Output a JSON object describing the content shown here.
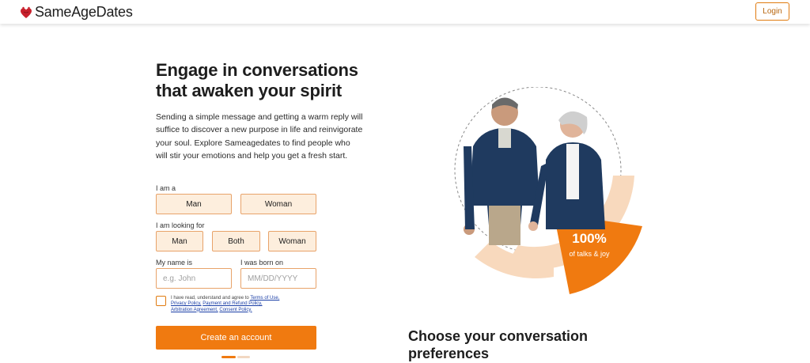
{
  "header": {
    "logo_text": "SameAgeDates",
    "login_label": "Login"
  },
  "hero": {
    "title_line1": "Engage in conversations",
    "title_line2": "that awaken your spirit",
    "description": "Sending a simple message and getting a warm reply will suffice to discover a new purpose in life and reinvigorate your soul. Explore Sameagedates to find people who will stir your emotions and help you get a fresh start."
  },
  "form": {
    "i_am_label": "I am a",
    "i_am_options": [
      "Man",
      "Woman"
    ],
    "looking_for_label": "I am looking for",
    "looking_for_options": [
      "Man",
      "Both",
      "Woman"
    ],
    "name_label": "My name is",
    "name_placeholder": "e.g. John",
    "born_label": "I was born on",
    "born_placeholder": "MM/DD/YYYY",
    "terms_prefix": "I have read, understand and agree to ",
    "terms_links": [
      "Terms of Use,",
      "Privacy Policy,",
      "Payment and Refund Policy,",
      "Arbitration Agreement,",
      "Consent Policy."
    ],
    "submit_label": "Create an account"
  },
  "stat": {
    "value": "100%",
    "label": "of talks & joy"
  },
  "section": {
    "title": "Choose your conversation preferences"
  },
  "colors": {
    "accent": "#f07a10",
    "accent_light": "#fdeedd",
    "peach": "#f8d9bd"
  }
}
